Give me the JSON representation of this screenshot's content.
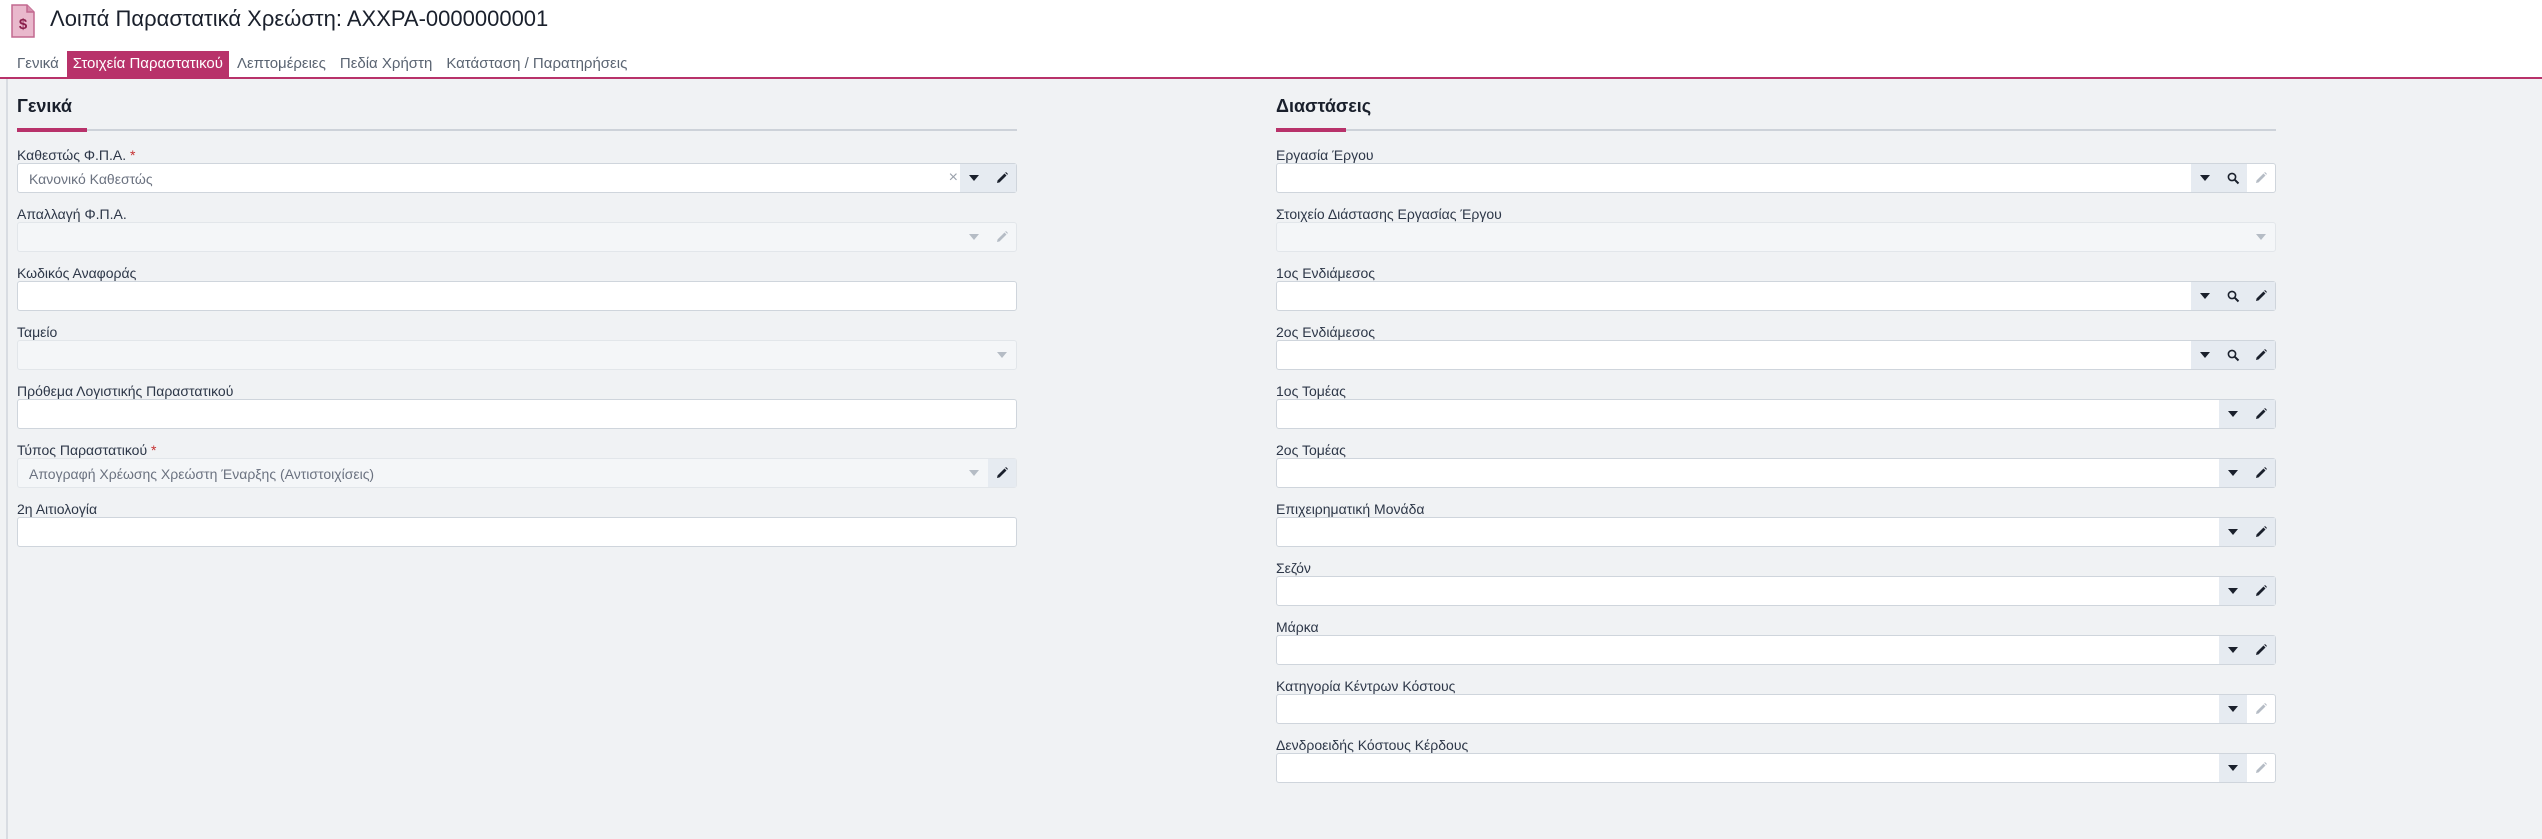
{
  "header": {
    "title": "Λοιπά Παραστατικά Χρεώστη: ΑΧΧΡΑ-0000000001",
    "doc_icon_glyph": "$"
  },
  "tabs": [
    {
      "label": "Γενικά",
      "active": false
    },
    {
      "label": "Στοιχεία Παραστατικού",
      "active": true
    },
    {
      "label": "Λεπτομέρειες",
      "active": false
    },
    {
      "label": "Πεδία Χρήστη",
      "active": false
    },
    {
      "label": "Κατάσταση / Παρατηρήσεις",
      "active": false
    }
  ],
  "left_section": {
    "title": "Γενικά",
    "fields": [
      {
        "label": "Καθεστώς Φ.Π.Α.",
        "required": "*",
        "value": "Κανονικό Καθεστώς"
      },
      {
        "label": "Απαλλαγή Φ.Π.Α.",
        "value": ""
      },
      {
        "label": "Κωδικός Αναφοράς",
        "value": ""
      },
      {
        "label": "Ταμείο",
        "value": ""
      },
      {
        "label": "Πρόθεμα Λογιστικής Παραστατικού",
        "value": ""
      },
      {
        "label": "Τύπος Παραστατικού",
        "required": "*",
        "value": "Απογραφή Χρέωσης Χρεώστη Έναρξης (Αντιστοιχίσεις)"
      },
      {
        "label": "2η Αιτιολογία",
        "value": ""
      }
    ]
  },
  "right_section": {
    "title": "Διαστάσεις",
    "fields": [
      {
        "label": "Εργασία Έργου",
        "value": ""
      },
      {
        "label": "Στοιχείο Διάστασης Εργασίας Έργου",
        "value": ""
      },
      {
        "label": "1ος Ενδιάμεσος",
        "value": ""
      },
      {
        "label": "2ος Ενδιάμεσος",
        "value": ""
      },
      {
        "label": "1ος Τομέας",
        "value": ""
      },
      {
        "label": "2ος Τομέας",
        "value": ""
      },
      {
        "label": "Επιχειρηματική Μονάδα",
        "value": ""
      },
      {
        "label": "Σεζόν",
        "value": ""
      },
      {
        "label": "Μάρκα",
        "value": ""
      },
      {
        "label": "Κατηγορία Κέντρων Κόστους",
        "value": ""
      },
      {
        "label": "Δενδροειδής Κόστους Κέρδους",
        "value": ""
      }
    ]
  },
  "icons": {
    "clear": "×",
    "caret": "▼"
  },
  "colors": {
    "accent": "#b8326a",
    "background": "#f0f2f4",
    "required": "#c53030"
  }
}
